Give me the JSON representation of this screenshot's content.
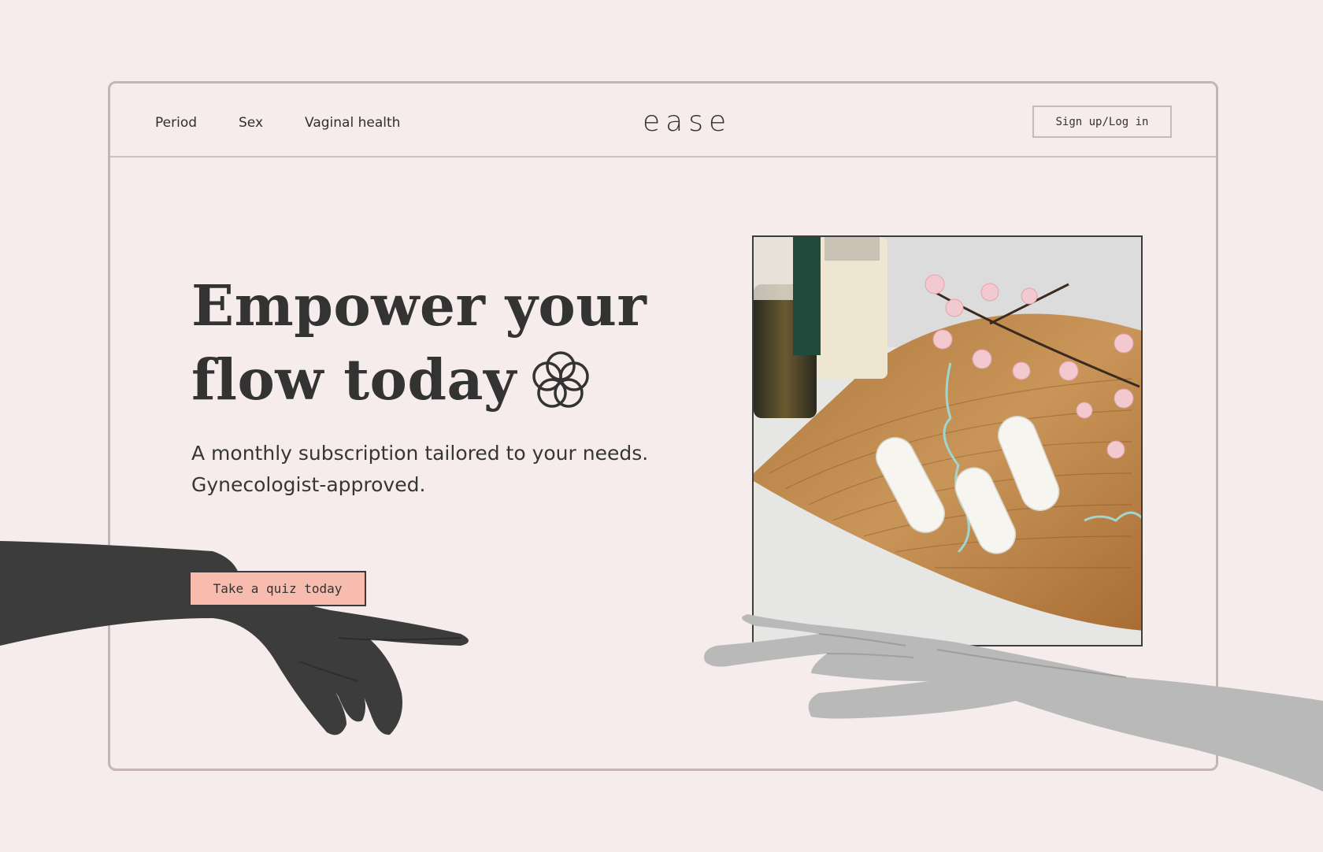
{
  "nav": {
    "items": [
      "Period",
      "Sex",
      "Vaginal health"
    ],
    "logo": "ease",
    "signup_label": "Sign up/Log in"
  },
  "hero": {
    "headline_line1": "Empower your",
    "headline_line2": "flow today",
    "subtitle_line1": "A monthly subscription tailored to your needs.",
    "subtitle_line2": "Gynecologist-approved.",
    "cta_label": "Take a quiz today",
    "icons": [
      "flower-icon"
    ]
  },
  "colors": {
    "background": "#f5eceb",
    "cta": "#f7bcae",
    "text": "#333333",
    "border": "#c5b5b4"
  }
}
